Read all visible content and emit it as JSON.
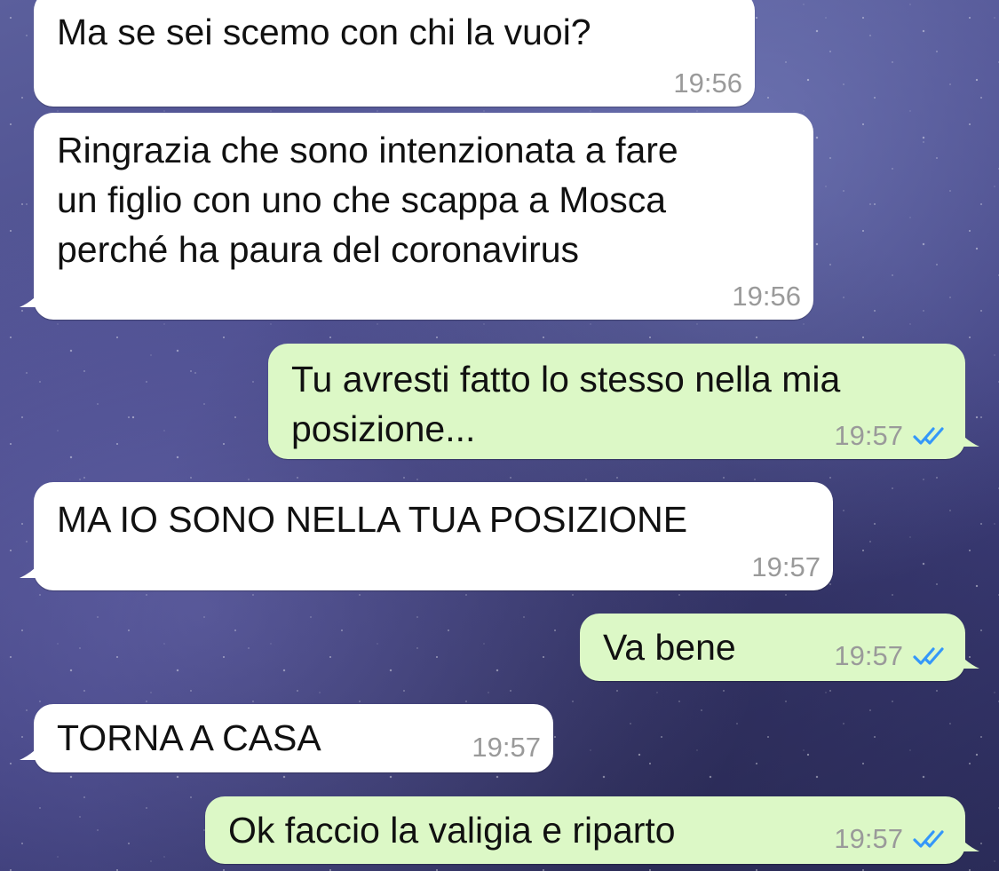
{
  "colors": {
    "incoming_bubble": "#ffffff",
    "outgoing_bubble": "#dcf8c6",
    "timestamp": "#9a9a9a",
    "read_checks": "#3497f9"
  },
  "messages": [
    {
      "direction": "incoming",
      "text": "Ma se sei scemo con chi la vuoi?",
      "time": "19:56"
    },
    {
      "direction": "incoming",
      "text": "Ringrazia che sono intenzionata a fare\nun figlio con uno che scappa a Mosca\nperché ha paura del coronavirus",
      "time": "19:56"
    },
    {
      "direction": "outgoing",
      "text": "Tu avresti fatto lo stesso nella mia\nposizione...",
      "time": "19:57",
      "status_icon": "double-check-read-icon"
    },
    {
      "direction": "incoming",
      "text": "MA IO SONO NELLA TUA POSIZIONE",
      "time": "19:57"
    },
    {
      "direction": "outgoing",
      "text": "Va bene",
      "time": "19:57",
      "status_icon": "double-check-read-icon"
    },
    {
      "direction": "incoming",
      "text": "TORNA A CASA",
      "time": "19:57"
    },
    {
      "direction": "outgoing",
      "text": "Ok faccio la valigia e riparto",
      "time": "19:57",
      "status_icon": "double-check-read-icon"
    }
  ]
}
